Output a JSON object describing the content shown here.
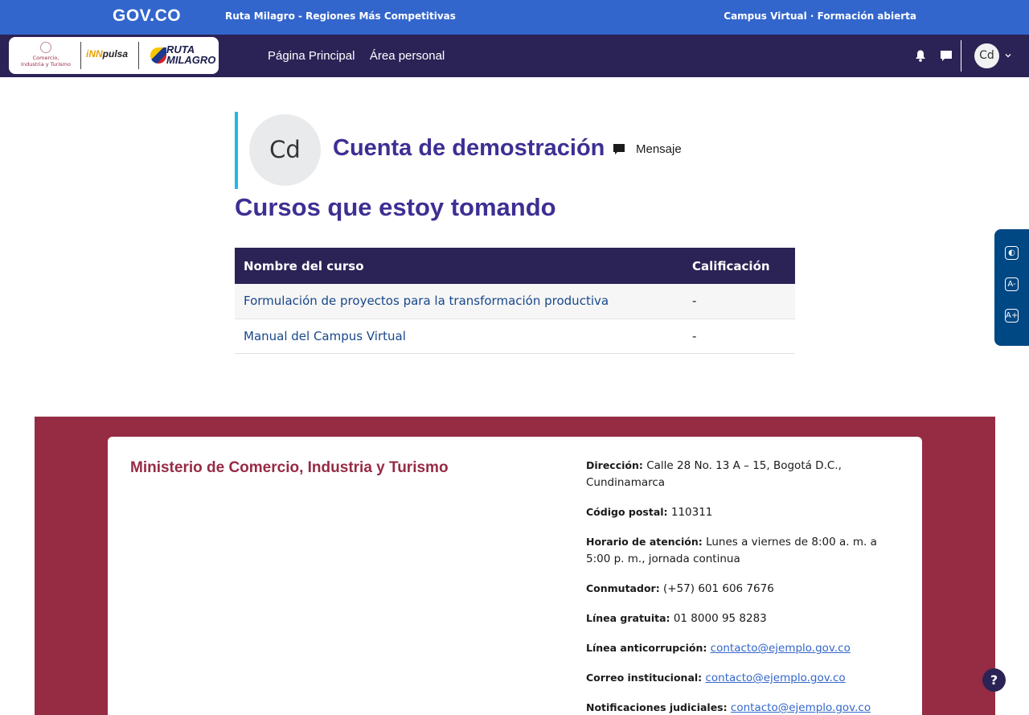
{
  "govbar": {
    "logo": "GOV.CO",
    "site_name": "Ruta Milagro - Regiones Más Competitivas",
    "campus": "Campus Virtual · Formación abierta"
  },
  "brand": {
    "mincit_line1": "Comercio,",
    "mincit_line2": "Industria y Turismo",
    "innpulsa_prefix": "iNN",
    "innpulsa_suffix": "pulsa",
    "ruta_line1": "RUTA",
    "ruta_line2": "MILAGRO"
  },
  "nav": {
    "links": [
      "Página Principal",
      "Área personal"
    ],
    "avatar_initials": "Cd"
  },
  "profile": {
    "avatar_initials": "Cd",
    "name": "Cuenta de demostración",
    "message_label": "Mensaje"
  },
  "courses": {
    "title": "Cursos que estoy tomando",
    "columns": [
      "Nombre del curso",
      "Calificación"
    ],
    "rows": [
      {
        "name": "Formulación de proyectos para la transformación productiva",
        "grade": "-"
      },
      {
        "name": "Manual del Campus Virtual",
        "grade": "-"
      }
    ]
  },
  "a11y": {
    "contrast_label": "◐",
    "font_smaller": "A-",
    "font_larger": "A+"
  },
  "footer": {
    "org": "Ministerio de Comercio, Industria y Turismo",
    "info": [
      {
        "label": "Dirección:",
        "value": "Calle 28 No. 13 A – 15, Bogotá D.C., Cundinamarca",
        "link": false
      },
      {
        "label": "Código postal:",
        "value": "110311",
        "link": false
      },
      {
        "label": "Horario de atención:",
        "value": "Lunes a viernes de 8:00 a. m. a 5:00 p. m., jornada continua",
        "link": false
      },
      {
        "label": "Conmutador:",
        "value": "(+57) 601 606 7676",
        "link": false
      },
      {
        "label": "Línea gratuita:",
        "value": "01 8000 95 8283",
        "link": false
      },
      {
        "label": "Línea anticorrupción:",
        "value": "contacto@ejemplo.gov.co",
        "link": true
      },
      {
        "label": "Correo institucional:",
        "value": "contacto@ejemplo.gov.co",
        "link": true
      },
      {
        "label": "Notificaciones judiciales:",
        "value": "contacto@ejemplo.gov.co",
        "link": true
      }
    ]
  },
  "help": {
    "label": "?"
  },
  "colors": {
    "gov_blue": "#3366cc",
    "nav_purple": "#2b2356",
    "heading_purple": "#3d2f93",
    "footer_red": "#962b44",
    "accent_cyan": "#20b7e8"
  }
}
